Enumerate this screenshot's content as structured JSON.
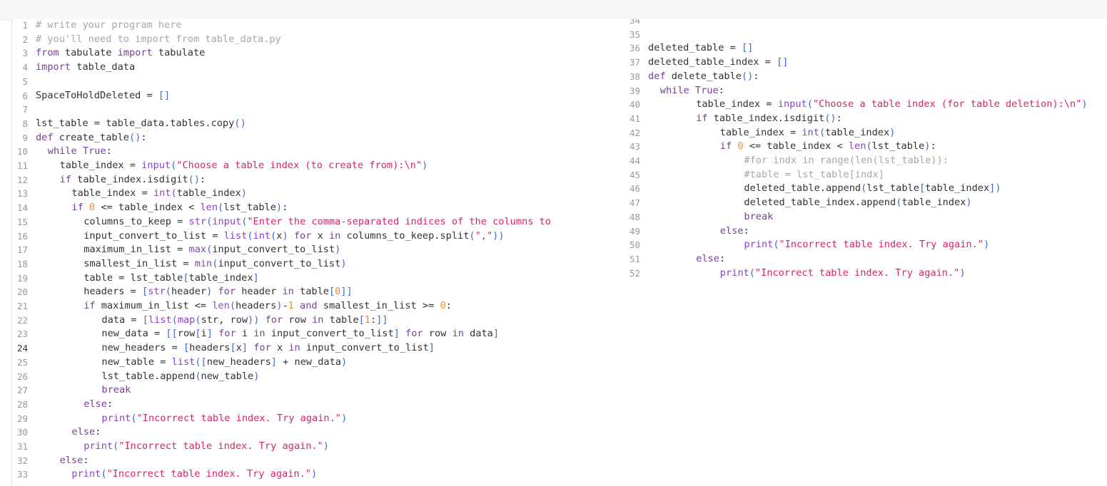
{
  "editor": {
    "active_line": 24,
    "left_pane": [
      {
        "n": "1",
        "i": 0,
        "t": [
          [
            "cm",
            "# write your program here"
          ]
        ]
      },
      {
        "n": "2",
        "i": 0,
        "t": [
          [
            "cm",
            "# you'll need to import from table_data.py"
          ]
        ]
      },
      {
        "n": "3",
        "i": 0,
        "t": [
          [
            "kw",
            "from"
          ],
          [
            "tx",
            " tabulate "
          ],
          [
            "kw",
            "import"
          ],
          [
            "tx",
            " tabulate"
          ]
        ]
      },
      {
        "n": "4",
        "i": 0,
        "t": [
          [
            "kw",
            "import"
          ],
          [
            "tx",
            " table_data"
          ]
        ]
      },
      {
        "n": "5",
        "i": 0,
        "t": []
      },
      {
        "n": "6",
        "i": 0,
        "t": [
          [
            "tx",
            "SpaceToHoldDeleted = "
          ],
          [
            "br",
            "[]"
          ]
        ]
      },
      {
        "n": "7",
        "i": 0,
        "t": []
      },
      {
        "n": "8",
        "i": 0,
        "t": [
          [
            "tx",
            "lst_table = table_data.tables.copy"
          ],
          [
            "br",
            "()"
          ]
        ]
      },
      {
        "n": "9",
        "i": 0,
        "t": [
          [
            "kw",
            "def"
          ],
          [
            "tx",
            " create_table"
          ],
          [
            "br",
            "()"
          ],
          [
            "tx",
            ":"
          ]
        ]
      },
      {
        "n": "10",
        "i": 1,
        "t": [
          [
            "kw",
            "while"
          ],
          [
            "tx",
            " "
          ],
          [
            "kw",
            "True"
          ],
          [
            "tx",
            ":"
          ]
        ]
      },
      {
        "n": "11",
        "i": 2,
        "t": [
          [
            "tx",
            "table_index = "
          ],
          [
            "bi",
            "input"
          ],
          [
            "br",
            "("
          ],
          [
            "st",
            "\"Choose a table index (to create from):\\n\""
          ],
          [
            "br",
            ")"
          ]
        ]
      },
      {
        "n": "12",
        "i": 2,
        "t": [
          [
            "kw",
            "if"
          ],
          [
            "tx",
            " table_index.isdigit"
          ],
          [
            "br",
            "()"
          ],
          [
            "tx",
            ":"
          ]
        ]
      },
      {
        "n": "13",
        "i": 3,
        "t": [
          [
            "tx",
            "table_index = "
          ],
          [
            "bi",
            "int"
          ],
          [
            "br",
            "("
          ],
          [
            "tx",
            "table_index"
          ],
          [
            "br",
            ")"
          ]
        ]
      },
      {
        "n": "14",
        "i": 3,
        "t": [
          [
            "kw",
            "if"
          ],
          [
            "tx",
            " "
          ],
          [
            "nm",
            "0"
          ],
          [
            "tx",
            " <= table_index < "
          ],
          [
            "bi",
            "len"
          ],
          [
            "br",
            "("
          ],
          [
            "tx",
            "lst_table"
          ],
          [
            "br",
            ")"
          ],
          [
            "tx",
            ":"
          ]
        ]
      },
      {
        "n": "15",
        "i": 4,
        "t": [
          [
            "tx",
            "columns_to_keep = "
          ],
          [
            "bi",
            "str"
          ],
          [
            "br",
            "("
          ],
          [
            "bi",
            "input"
          ],
          [
            "br",
            "("
          ],
          [
            "st",
            "\"Enter the comma-separated indices of the columns to"
          ]
        ]
      },
      {
        "n": "16",
        "i": 4,
        "t": [
          [
            "tx",
            "input_convert_to_list = "
          ],
          [
            "bi",
            "list"
          ],
          [
            "br",
            "("
          ],
          [
            "bi",
            "int"
          ],
          [
            "br",
            "("
          ],
          [
            "tx",
            "x"
          ],
          [
            "br",
            ")"
          ],
          [
            "tx",
            " "
          ],
          [
            "kw",
            "for"
          ],
          [
            "tx",
            " x "
          ],
          [
            "kw",
            "in"
          ],
          [
            "tx",
            " columns_to_keep.split"
          ],
          [
            "br",
            "("
          ],
          [
            "st",
            "\",\""
          ],
          [
            "br",
            "))"
          ]
        ]
      },
      {
        "n": "17",
        "i": 4,
        "t": [
          [
            "tx",
            "maximum_in_list = "
          ],
          [
            "bi",
            "max"
          ],
          [
            "br",
            "("
          ],
          [
            "tx",
            "input_convert_to_list"
          ],
          [
            "br",
            ")"
          ]
        ]
      },
      {
        "n": "18",
        "i": 4,
        "t": [
          [
            "tx",
            "smallest_in_list = "
          ],
          [
            "bi",
            "min"
          ],
          [
            "br",
            "("
          ],
          [
            "tx",
            "input_convert_to_list"
          ],
          [
            "br",
            ")"
          ]
        ]
      },
      {
        "n": "19",
        "i": 4,
        "t": [
          [
            "tx",
            "table = lst_table"
          ],
          [
            "br",
            "["
          ],
          [
            "tx",
            "table_index"
          ],
          [
            "br",
            "]"
          ]
        ]
      },
      {
        "n": "20",
        "i": 4,
        "t": [
          [
            "tx",
            "headers = "
          ],
          [
            "br",
            "["
          ],
          [
            "bi",
            "str"
          ],
          [
            "br",
            "("
          ],
          [
            "tx",
            "header"
          ],
          [
            "br",
            ")"
          ],
          [
            "tx",
            " "
          ],
          [
            "kw",
            "for"
          ],
          [
            "tx",
            " header "
          ],
          [
            "kw",
            "in"
          ],
          [
            "tx",
            " table"
          ],
          [
            "br",
            "["
          ],
          [
            "nm",
            "0"
          ],
          [
            "br",
            "]]"
          ]
        ]
      },
      {
        "n": "21",
        "i": 4,
        "t": [
          [
            "kw",
            "if"
          ],
          [
            "tx",
            " maximum_in_list <= "
          ],
          [
            "bi",
            "len"
          ],
          [
            "br",
            "("
          ],
          [
            "tx",
            "headers"
          ],
          [
            "br",
            ")"
          ],
          [
            "op",
            "-"
          ],
          [
            "nm",
            "1"
          ],
          [
            "tx",
            " "
          ],
          [
            "kw",
            "and"
          ],
          [
            "tx",
            " smallest_in_list >= "
          ],
          [
            "nm",
            "0"
          ],
          [
            "tx",
            ":"
          ]
        ]
      },
      {
        "n": "22",
        "i": 5.5,
        "t": [
          [
            "tx",
            "data = "
          ],
          [
            "br",
            "["
          ],
          [
            "bi",
            "list"
          ],
          [
            "br",
            "("
          ],
          [
            "bi",
            "map"
          ],
          [
            "br",
            "("
          ],
          [
            "tx",
            "str, row"
          ],
          [
            "br",
            "))"
          ],
          [
            "tx",
            " "
          ],
          [
            "kw",
            "for"
          ],
          [
            "tx",
            " row "
          ],
          [
            "kw",
            "in"
          ],
          [
            "tx",
            " table"
          ],
          [
            "br",
            "["
          ],
          [
            "nm",
            "1"
          ],
          [
            "tx",
            ":"
          ],
          [
            "br",
            "]]"
          ]
        ]
      },
      {
        "n": "23",
        "i": 5.5,
        "t": [
          [
            "tx",
            "new_data = "
          ],
          [
            "br",
            "[["
          ],
          [
            "tx",
            "row"
          ],
          [
            "br",
            "["
          ],
          [
            "tx",
            "i"
          ],
          [
            "br",
            "]"
          ],
          [
            "tx",
            " "
          ],
          [
            "kw",
            "for"
          ],
          [
            "tx",
            " i "
          ],
          [
            "kw",
            "in"
          ],
          [
            "tx",
            " input_convert_to_list"
          ],
          [
            "br",
            "]"
          ],
          [
            "tx",
            " "
          ],
          [
            "kw",
            "for"
          ],
          [
            "tx",
            " row "
          ],
          [
            "kw",
            "in"
          ],
          [
            "tx",
            " data"
          ],
          [
            "br",
            "]"
          ]
        ]
      },
      {
        "n": "24",
        "i": 5.5,
        "t": [
          [
            "tx",
            "new_headers = "
          ],
          [
            "br",
            "["
          ],
          [
            "tx",
            "headers"
          ],
          [
            "br",
            "["
          ],
          [
            "tx",
            "x"
          ],
          [
            "br",
            "]"
          ],
          [
            "tx",
            " "
          ],
          [
            "kw",
            "for"
          ],
          [
            "tx",
            " x "
          ],
          [
            "kw",
            "in"
          ],
          [
            "tx",
            " input_convert_to_list"
          ],
          [
            "br",
            "]"
          ]
        ]
      },
      {
        "n": "25",
        "i": 5.5,
        "t": [
          [
            "tx",
            "new_table = "
          ],
          [
            "bi",
            "list"
          ],
          [
            "br",
            "(["
          ],
          [
            "tx",
            "new_headers"
          ],
          [
            "br",
            "]"
          ],
          [
            "tx",
            " + new_data"
          ],
          [
            "br",
            ")"
          ]
        ]
      },
      {
        "n": "26",
        "i": 5.5,
        "t": [
          [
            "tx",
            "lst_table.append"
          ],
          [
            "br",
            "("
          ],
          [
            "tx",
            "new_table"
          ],
          [
            "br",
            ")"
          ]
        ]
      },
      {
        "n": "27",
        "i": 5.5,
        "t": [
          [
            "kw",
            "break"
          ]
        ]
      },
      {
        "n": "28",
        "i": 4,
        "t": [
          [
            "kw",
            "else"
          ],
          [
            "tx",
            ":"
          ]
        ]
      },
      {
        "n": "29",
        "i": 5.5,
        "t": [
          [
            "bi",
            "print"
          ],
          [
            "br",
            "("
          ],
          [
            "st",
            "\"Incorrect table index. Try again.\""
          ],
          [
            "br",
            ")"
          ]
        ]
      },
      {
        "n": "30",
        "i": 3,
        "t": [
          [
            "kw",
            "else"
          ],
          [
            "tx",
            ":"
          ]
        ]
      },
      {
        "n": "31",
        "i": 4,
        "t": [
          [
            "bi",
            "print"
          ],
          [
            "br",
            "("
          ],
          [
            "st",
            "\"Incorrect table index. Try again.\""
          ],
          [
            "br",
            ")"
          ]
        ]
      },
      {
        "n": "32",
        "i": 2,
        "t": [
          [
            "kw",
            "else"
          ],
          [
            "tx",
            ":"
          ]
        ]
      },
      {
        "n": "33",
        "i": 3,
        "t": [
          [
            "bi",
            "print"
          ],
          [
            "br",
            "("
          ],
          [
            "st",
            "\"Incorrect table index. Try again.\""
          ],
          [
            "br",
            ")"
          ]
        ]
      }
    ],
    "right_pane": [
      {
        "n": "34",
        "i": 0,
        "t": []
      },
      {
        "n": "35",
        "i": 0,
        "t": []
      },
      {
        "n": "36",
        "i": 0,
        "t": [
          [
            "tx",
            "deleted_table = "
          ],
          [
            "br",
            "[]"
          ]
        ]
      },
      {
        "n": "37",
        "i": 0,
        "t": [
          [
            "tx",
            "deleted_table_index = "
          ],
          [
            "br",
            "[]"
          ]
        ]
      },
      {
        "n": "38",
        "i": 0,
        "t": [
          [
            "kw",
            "def"
          ],
          [
            "tx",
            " delete_table"
          ],
          [
            "br",
            "()"
          ],
          [
            "tx",
            ":"
          ]
        ]
      },
      {
        "n": "39",
        "i": 1,
        "t": [
          [
            "kw",
            "while"
          ],
          [
            "tx",
            " "
          ],
          [
            "kw",
            "True"
          ],
          [
            "tx",
            ":"
          ]
        ]
      },
      {
        "n": "40",
        "i": 4,
        "t": [
          [
            "tx",
            "table_index = "
          ],
          [
            "bi",
            "input"
          ],
          [
            "br",
            "("
          ],
          [
            "st",
            "\"Choose a table index (for table deletion):\\n\""
          ],
          [
            "br",
            ")"
          ]
        ]
      },
      {
        "n": "41",
        "i": 4,
        "t": [
          [
            "kw",
            "if"
          ],
          [
            "tx",
            " table_index.isdigit"
          ],
          [
            "br",
            "()"
          ],
          [
            "tx",
            ":"
          ]
        ]
      },
      {
        "n": "42",
        "i": 6,
        "t": [
          [
            "tx",
            "table_index = "
          ],
          [
            "bi",
            "int"
          ],
          [
            "br",
            "("
          ],
          [
            "tx",
            "table_index"
          ],
          [
            "br",
            ")"
          ]
        ]
      },
      {
        "n": "43",
        "i": 6,
        "t": [
          [
            "kw",
            "if"
          ],
          [
            "tx",
            " "
          ],
          [
            "nm",
            "0"
          ],
          [
            "tx",
            " <= table_index < "
          ],
          [
            "bi",
            "len"
          ],
          [
            "br",
            "("
          ],
          [
            "tx",
            "lst_table"
          ],
          [
            "br",
            ")"
          ],
          [
            "tx",
            ":"
          ]
        ]
      },
      {
        "n": "44",
        "i": 8,
        "t": [
          [
            "cm",
            "#for indx in range(len(lst_table)):"
          ]
        ]
      },
      {
        "n": "45",
        "i": 8,
        "t": [
          [
            "cm",
            "#table = lst_table[indx]"
          ]
        ]
      },
      {
        "n": "46",
        "i": 8,
        "t": [
          [
            "tx",
            "deleted_table.append"
          ],
          [
            "br",
            "("
          ],
          [
            "tx",
            "lst_table"
          ],
          [
            "br",
            "["
          ],
          [
            "tx",
            "table_index"
          ],
          [
            "br",
            "])"
          ]
        ]
      },
      {
        "n": "47",
        "i": 8,
        "t": [
          [
            "tx",
            "deleted_table_index.append"
          ],
          [
            "br",
            "("
          ],
          [
            "tx",
            "table_index"
          ],
          [
            "br",
            ")"
          ]
        ]
      },
      {
        "n": "48",
        "i": 8,
        "t": [
          [
            "kw",
            "break"
          ]
        ]
      },
      {
        "n": "49",
        "i": 6,
        "t": [
          [
            "kw",
            "else"
          ],
          [
            "tx",
            ":"
          ]
        ]
      },
      {
        "n": "50",
        "i": 8,
        "t": [
          [
            "bi",
            "print"
          ],
          [
            "br",
            "("
          ],
          [
            "st",
            "\"Incorrect table index. Try again.\""
          ],
          [
            "br",
            ")"
          ]
        ]
      },
      {
        "n": "51",
        "i": 4,
        "t": [
          [
            "kw",
            "else"
          ],
          [
            "tx",
            ":"
          ]
        ]
      },
      {
        "n": "52",
        "i": 6,
        "t": [
          [
            "bi",
            "print"
          ],
          [
            "br",
            "("
          ],
          [
            "st",
            "\"Incorrect table index. Try again.\""
          ],
          [
            "br",
            ")"
          ]
        ]
      }
    ]
  }
}
